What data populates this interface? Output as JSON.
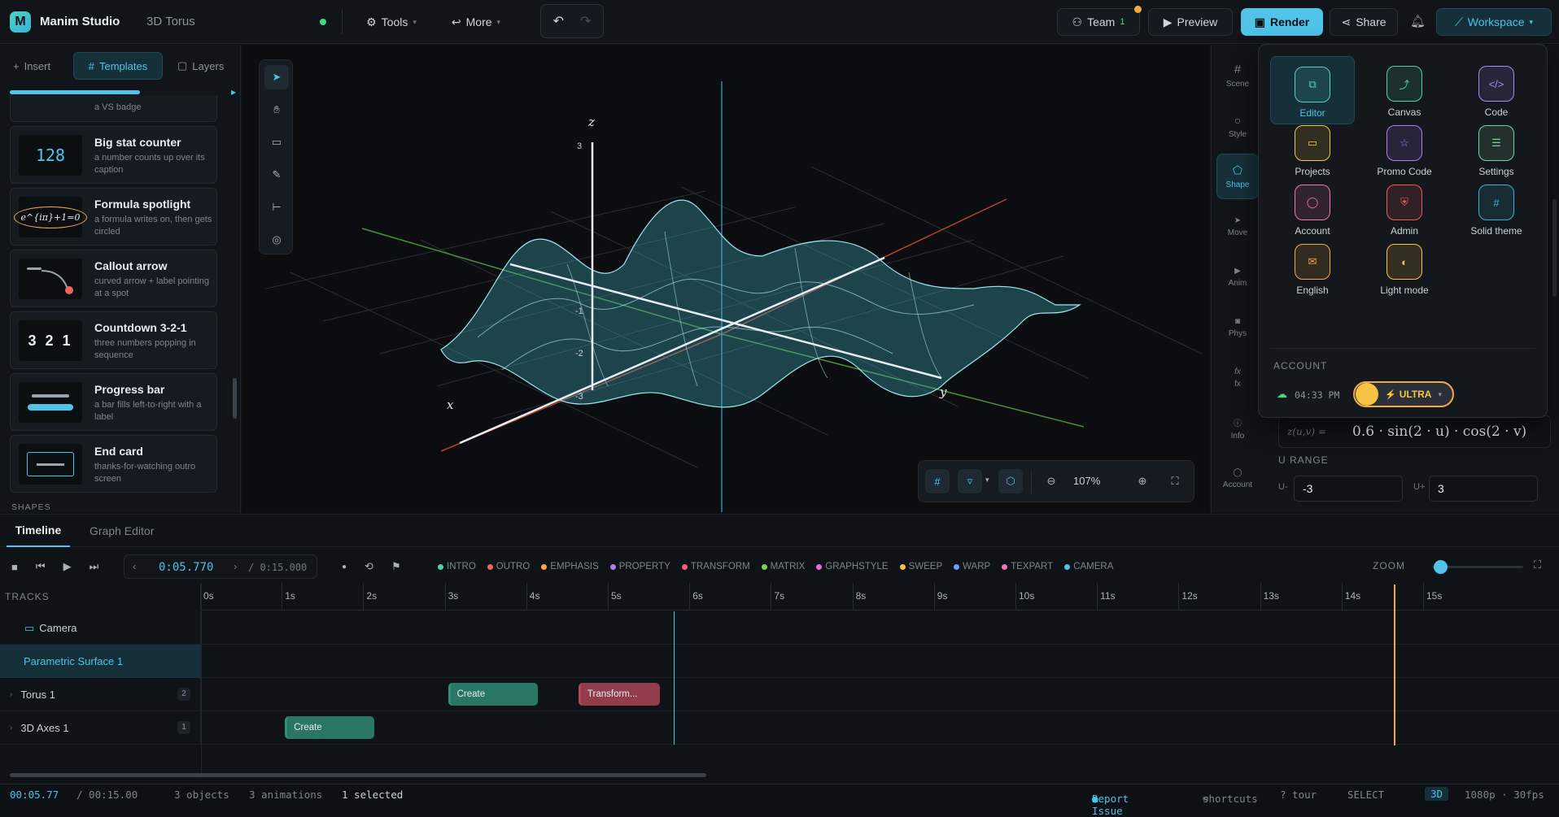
{
  "header": {
    "app_name": "Manim Studio",
    "project_name": "3D Torus",
    "tools_label": "Tools",
    "more_label": "More",
    "team_label": "Team",
    "team_count": "1",
    "preview_label": "Preview",
    "render_label": "Render",
    "share_label": "Share",
    "workspace_label": "Workspace"
  },
  "left_panel": {
    "tabs": [
      {
        "label": "Insert"
      },
      {
        "label": "Templates"
      },
      {
        "label": "Layers"
      }
    ],
    "partial_card_desc": "a VS badge",
    "cards": [
      {
        "title": "Big stat counter",
        "desc": "a number counts up over its caption",
        "thumb": "128"
      },
      {
        "title": "Formula spotlight",
        "desc": "a formula writes on, then gets circled",
        "thumb": "e^{iπ}+1=0"
      },
      {
        "title": "Callout arrow",
        "desc": "curved arrow + label pointing at a spot",
        "thumb": ""
      },
      {
        "title": "Countdown 3-2-1",
        "desc": "three numbers popping in sequence",
        "thumb": "3 2 1"
      },
      {
        "title": "Progress bar",
        "desc": "a bar fills left-to-right with a label",
        "thumb": ""
      },
      {
        "title": "End card",
        "desc": "thanks-for-watching outro screen",
        "thumb": ""
      }
    ],
    "section_label": "SHAPES"
  },
  "viewport": {
    "axis_labels": {
      "x": "x",
      "y": "y",
      "z": "z"
    },
    "z_ticks": [
      "3",
      "-1",
      "-2",
      "-3"
    ],
    "zoom_level": "107%"
  },
  "right_rail": [
    {
      "label": "Scene"
    },
    {
      "label": "Style"
    },
    {
      "label": "Shape"
    },
    {
      "label": "Move"
    },
    {
      "label": "Anim"
    },
    {
      "label": "Phys"
    },
    {
      "label": "fx"
    },
    {
      "label": "Info"
    },
    {
      "label": "Account"
    }
  ],
  "right_panel": {
    "formula_prefix": "z(u,v) =",
    "formula": "0.6 · sin(2 · u) · cos(2 · v)",
    "u_range_title": "U RANGE",
    "u_min_label": "U-",
    "u_min": "-3",
    "u_max_label": "U+",
    "u_max": "3"
  },
  "workspace_menu": {
    "items": [
      {
        "label": "Editor",
        "color": "#4fd1c5"
      },
      {
        "label": "Canvas",
        "color": "#4fd1a5"
      },
      {
        "label": "Code",
        "color": "#a78bfa"
      },
      {
        "label": "Projects",
        "color": "#f6c343"
      },
      {
        "label": "Promo Code",
        "color": "#b07cf5"
      },
      {
        "label": "Settings",
        "color": "#7fcf9a"
      },
      {
        "label": "Account",
        "color": "#f472b6"
      },
      {
        "label": "Admin",
        "color": "#f05a5a"
      },
      {
        "label": "Solid theme",
        "color": "#38b2d8"
      },
      {
        "label": "English",
        "color": "#f6a943"
      },
      {
        "label": "Light mode",
        "color": "#f6c343"
      }
    ],
    "account_title": "ACCOUNT",
    "time": "04:33 PM",
    "plan": "ULTRA"
  },
  "timeline": {
    "tabs": [
      {
        "label": "Timeline"
      },
      {
        "label": "Graph Editor"
      }
    ],
    "current_time": "0:05.770",
    "total_time": "/ 0:15.000",
    "categories": [
      {
        "label": "INTRO",
        "color": "#4fd1a5"
      },
      {
        "label": "OUTRO",
        "color": "#f0645a"
      },
      {
        "label": "EMPHASIS",
        "color": "#f6a943"
      },
      {
        "label": "PROPERTY",
        "color": "#b07cf5"
      },
      {
        "label": "TRANSFORM",
        "color": "#f0607a"
      },
      {
        "label": "MATRIX",
        "color": "#7fcf5a"
      },
      {
        "label": "GRAPHSTYLE",
        "color": "#e36fd6"
      },
      {
        "label": "SWEEP",
        "color": "#f6c343"
      },
      {
        "label": "WARP",
        "color": "#6f9cf5"
      },
      {
        "label": "TEXPART",
        "color": "#f472b6"
      },
      {
        "label": "CAMERA",
        "color": "#4fc3e8"
      }
    ],
    "zoom_label": "ZOOM",
    "tracks_label": "TRACKS",
    "ruler": [
      "0s",
      "1s",
      "2s",
      "3s",
      "4s",
      "5s",
      "6s",
      "7s",
      "8s",
      "9s",
      "10s",
      "11s",
      "12s",
      "13s",
      "14s",
      "15s"
    ],
    "tracks": [
      {
        "name": "Camera",
        "count": ""
      },
      {
        "name": "Parametric Surface 1",
        "count": ""
      },
      {
        "name": "Torus 1",
        "count": "2"
      },
      {
        "name": "3D Axes 1",
        "count": "1"
      }
    ],
    "clips": [
      {
        "label": "Create",
        "track": 2,
        "start": 3.0,
        "end": 4.1,
        "color": "#2f8f7a"
      },
      {
        "label": "Transform...",
        "track": 2,
        "start": 4.6,
        "end": 5.6,
        "color": "#b3475a"
      },
      {
        "label": "Create",
        "track": 3,
        "start": 1.0,
        "end": 2.1,
        "color": "#2f8f7a"
      }
    ],
    "playhead": 5.77
  },
  "status_bar": {
    "time": "00:05.77",
    "total": "/ 00:15.00",
    "objects": "3 objects",
    "animations": "3 animations",
    "selected": "1 selected",
    "report": "Report Issue",
    "shortcuts": "shortcuts",
    "tour": "? tour",
    "mode": "SELECT",
    "dim": "3D",
    "quality": "1080p · 30fps"
  }
}
